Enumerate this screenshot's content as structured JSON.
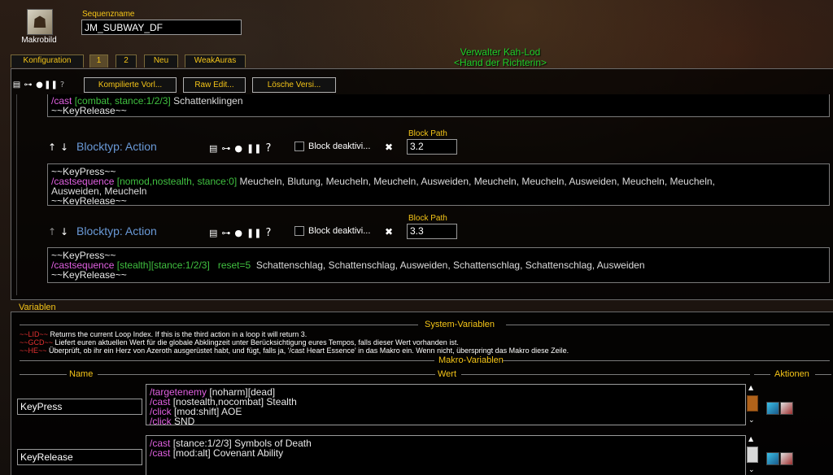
{
  "app": {
    "macro_icon_label": "Makrobild",
    "sequence_label": "Sequenzname",
    "sequence_value": "JM_SUBWAY_DF"
  },
  "npc": {
    "name": "Verwalter Kah-Lod",
    "title": "<Hand der Richterin>"
  },
  "tabs": [
    {
      "label": "Konfiguration",
      "active": false
    },
    {
      "label": "1",
      "active": true
    },
    {
      "label": "2",
      "active": false
    },
    {
      "label": "Neu",
      "active": false
    },
    {
      "label": "WeakAuras",
      "active": false
    }
  ],
  "toolbar": {
    "compile_label": "Kompilierte Vorl...",
    "raw_label": "Raw Edit...",
    "delete_label": "Lösche Versi..."
  },
  "blocks": {
    "top_partial": {
      "line1_kw": "/cast",
      "line1_cond": "[combat, stance:1/2/3]",
      "line1_spell": "Schattenklingen",
      "line2": "~~KeyRelease~~"
    },
    "b32": {
      "type_label": "Blocktyp: Action",
      "disable_label": "Block deaktivi...",
      "path_label": "Block Path",
      "path_value": "3.2",
      "line1": "~~KeyPress~~",
      "line2_kw": "/castsequence",
      "line2_cond": "[nomod,nostealth, stance:0]",
      "line2_spells": "Meucheln, Blutung, Meucheln, Meucheln, Ausweiden, Meucheln, Meucheln, Ausweiden, Meucheln, Meucheln,",
      "line3": "Ausweiden, Meucheln",
      "line4": "~~KeyRelease~~"
    },
    "b33": {
      "type_label": "Blocktyp: Action",
      "disable_label": "Block deaktivi...",
      "path_label": "Block Path",
      "path_value": "3.3",
      "line1": "~~KeyPress~~",
      "line2_kw": "/castsequence",
      "line2_cond": "[stealth][stance:1/2/3]",
      "line2_reset": "reset=5",
      "line2_spells": "Schattenschlag, Schattenschlag, Ausweiden, Schattenschlag, Schattenschlag, Ausweiden",
      "line3": "~~KeyRelease~~"
    }
  },
  "variables": {
    "title": "Variablen",
    "system_title": "System-Variablen",
    "sys": [
      {
        "name": "~~LID~~",
        "desc": "Returns the current Loop Index.  If this is the third action in a loop it will return 3."
      },
      {
        "name": "~~GCD~~",
        "desc": "Liefert euren aktuellen Wert für die globale Abklingzeit unter Berücksichtigung eures Tempos, falls dieser Wert vorhanden ist."
      },
      {
        "name": "~~HE~~",
        "desc": "Überprüft, ob ihr ein Herz von Azeroth ausgerüstet habt, und fügt, falls ja, '/cast Heart Essence' in das Makro ein. Wenn nicht, überspringt das Makro diese Zeile."
      }
    ],
    "macro_title": "Makro-Variablen",
    "col_name": "Name",
    "col_value": "Wert",
    "col_actions": "Aktionen",
    "rows": [
      {
        "name": "KeyPress",
        "lines": [
          {
            "kw": "/targetenemy",
            "rest": "[noharm][dead]"
          },
          {
            "kw": "/cast",
            "rest": "[nostealth,nocombat] Stealth"
          },
          {
            "kw": "/click",
            "rest": "[mod:shift] AOE"
          },
          {
            "kw": "/click",
            "rest": "SND"
          }
        ]
      },
      {
        "name": "KeyRelease",
        "lines": [
          {
            "kw": "/cast",
            "rest": "[stance:1/2/3] Symbols of Death"
          },
          {
            "kw": "/cast",
            "rest": "[mod:alt] Covenant Ability"
          }
        ]
      }
    ]
  },
  "colors": {
    "gold": "#f5c518",
    "keyword": "#e060e0",
    "condition": "#40c040",
    "blocktype": "#6a9ad8",
    "npc": "#1fd12a"
  }
}
